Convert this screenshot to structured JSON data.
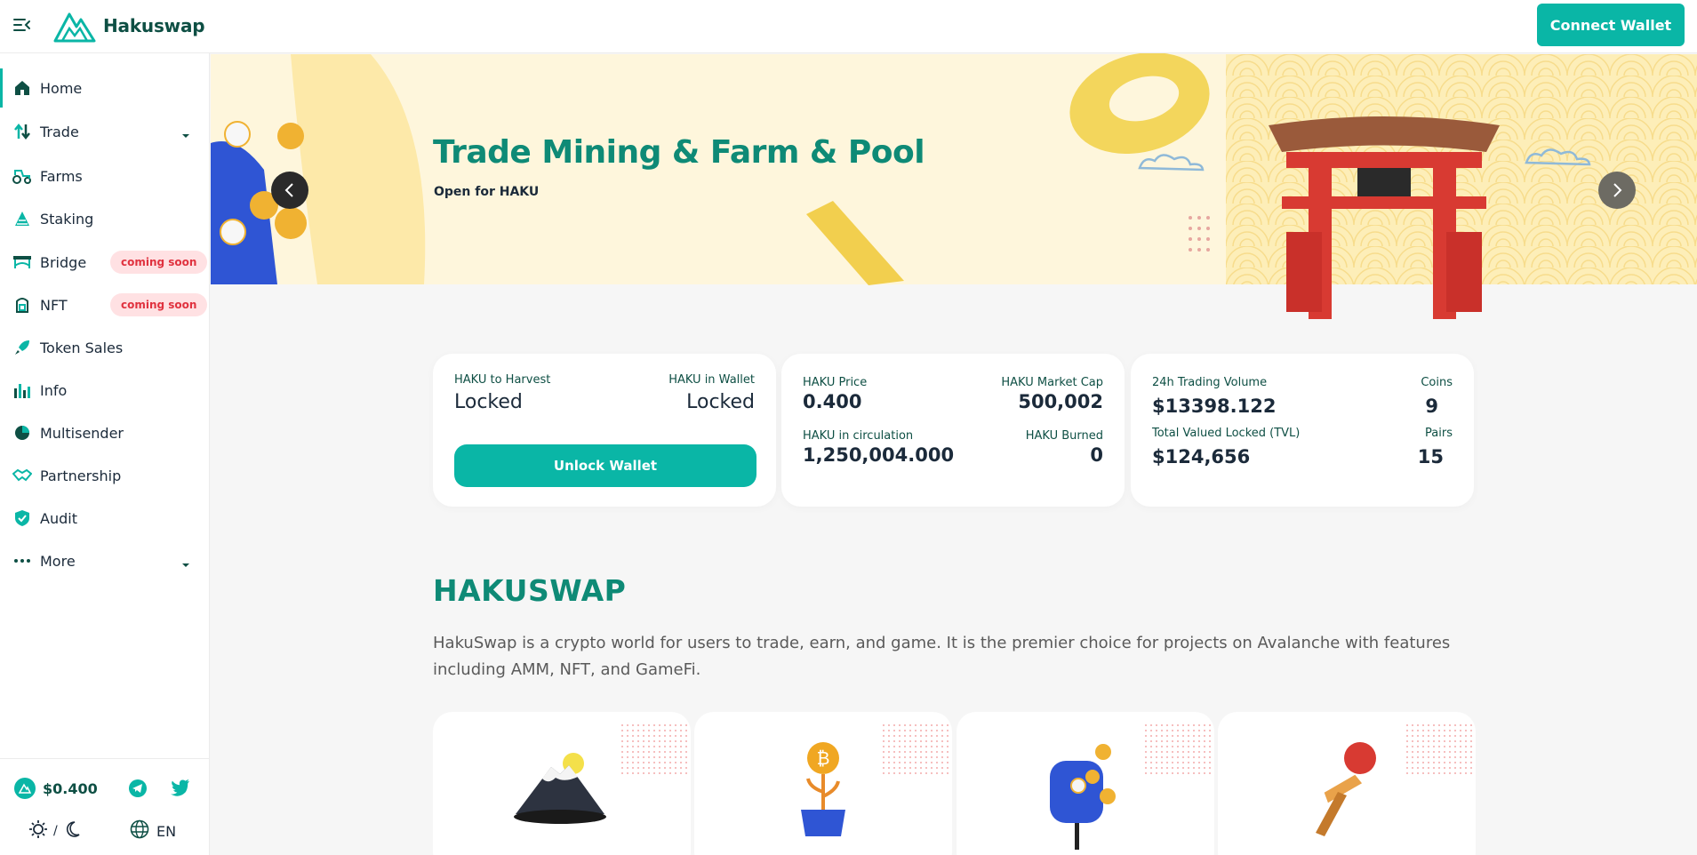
{
  "header": {
    "brand": "Hakuswap",
    "connect_label": "Connect Wallet"
  },
  "sidebar": {
    "items": [
      {
        "label": "Home",
        "icon": "home-icon"
      },
      {
        "label": "Trade",
        "icon": "trade-icon"
      },
      {
        "label": "Farms",
        "icon": "tractor-icon"
      },
      {
        "label": "Staking",
        "icon": "staking-icon"
      },
      {
        "label": "Bridge",
        "icon": "bridge-icon",
        "badge": "coming soon"
      },
      {
        "label": "NFT",
        "icon": "nft-icon",
        "badge": "coming soon"
      },
      {
        "label": "Token Sales",
        "icon": "rocket-icon"
      },
      {
        "label": "Info",
        "icon": "chart-icon"
      },
      {
        "label": "Multisender",
        "icon": "pie-icon"
      },
      {
        "label": "Partnership",
        "icon": "handshake-icon"
      },
      {
        "label": "Audit",
        "icon": "shield-icon"
      },
      {
        "label": "More",
        "icon": "more-icon"
      }
    ],
    "footer": {
      "price": "$0.400",
      "language": "EN",
      "theme_separator": "/"
    }
  },
  "banner": {
    "title": "Trade Mining & Farm & Pool",
    "subtitle": "Open for HAKU"
  },
  "stats": {
    "harvest_label": "HAKU to Harvest",
    "harvest_value": "Locked",
    "wallet_label": "HAKU in Wallet",
    "wallet_value": "Locked",
    "unlock_label": "Unlock Wallet",
    "price_label": "HAKU Price",
    "price_value": "0.400",
    "mcap_label": "HAKU Market Cap",
    "mcap_value": "500,002",
    "circ_label": "HAKU in circulation",
    "circ_value": "1,250,004.000",
    "burned_label": "HAKU Burned",
    "burned_value": "0",
    "volume_label": "24h Trading Volume",
    "volume_value": "$13398.122",
    "coins_label": "Coins",
    "coins_value": "9",
    "tvl_label": "Total Valued Locked (TVL)",
    "tvl_value": "$124,656",
    "pairs_label": "Pairs",
    "pairs_value": "15"
  },
  "about": {
    "title": "HAKUSWAP",
    "text": "HakuSwap is a crypto world for users to trade, earn, and game. It is the premier choice for projects on Avalanche with features including AMM, NFT, and GameFi."
  },
  "colors": {
    "accent": "#0ab6a6",
    "brand_dark": "#0e4f44",
    "title_green": "#0e8a76",
    "badge_bg": "#ffe1e3",
    "badge_text": "#e0323f"
  }
}
